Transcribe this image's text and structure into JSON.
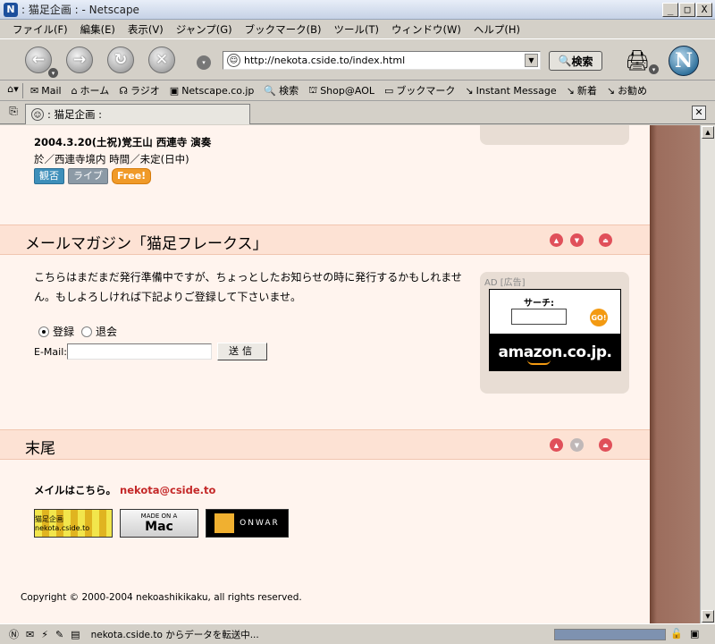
{
  "window": {
    "title": ": 猫足企画 : - Netscape",
    "min": "_",
    "max": "□",
    "close": "X"
  },
  "menu": [
    "ファイル(F)",
    "編集(E)",
    "表示(V)",
    "ジャンプ(G)",
    "ブックマーク(B)",
    "ツール(T)",
    "ウィンドウ(W)",
    "ヘルプ(H)"
  ],
  "nav": {
    "url": "http://nekota.cside.to/index.html",
    "search_label": "検索",
    "logo": "N"
  },
  "personal_toolbar": [
    "Mail",
    "ホーム",
    "ラジオ",
    "Netscape.co.jp",
    "検索",
    "Shop@AOL",
    "ブックマーク",
    "Instant Message",
    "新着",
    "お勧め"
  ],
  "tab": {
    "label": ": 猫足企画 :"
  },
  "page": {
    "event_title": "2004.3.20(土祝)覚王山 西連寺 演奏",
    "event_sub": "於／西連寺境内 時間／未定(日中)",
    "badges": [
      "観否",
      "ライブ",
      "Free!"
    ],
    "mail_section": {
      "title": "メールマガジン「猫足フレークス」",
      "text": "こちらはまだまだ発行準備中ですが、ちょっとしたお知らせの時に発行するかもしれません。もしよろしければ下記よりご登録して下さいませ。",
      "radio_subscribe": "登録",
      "radio_unsubscribe": "退会",
      "email_label": "E-Mail:",
      "email_value": "",
      "send": "送信"
    },
    "ad": {
      "label": "AD [広告]",
      "search_label": "サーチ:",
      "go": "GO!",
      "logo": "amazon.co.jp."
    },
    "footer_section": {
      "title": "末尾",
      "contact_prefix": "メイルはこちら。",
      "email": "nekota@cside.to",
      "banners": [
        "猫足企画 nekota.cside.to",
        "MADE ON A",
        "Mac",
        "ONWAR"
      ],
      "copyright": "Copyright © 2000-2004 nekoashikikaku, all rights reserved."
    }
  },
  "status": {
    "text": "nekota.cside.to からデータを転送中...",
    "progress": 1.0
  }
}
